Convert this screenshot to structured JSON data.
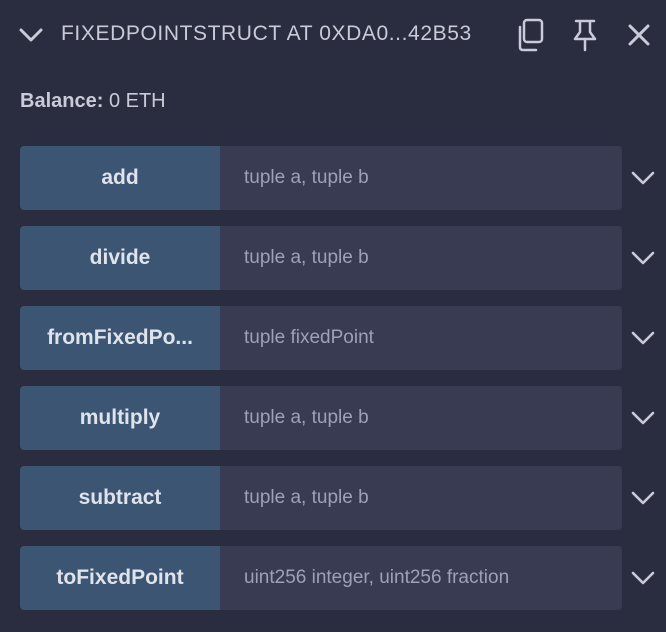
{
  "header": {
    "title": "FIXEDPOINTSTRUCT AT 0XDA0...42B53",
    "icons": {
      "collapse": "chevron-down-icon",
      "copy": "copy-icon",
      "pin": "pin-icon",
      "close": "close-icon"
    }
  },
  "balance": {
    "label": "Balance:",
    "value": "0 ETH"
  },
  "functions": [
    {
      "name": "add",
      "placeholder": "tuple a, tuple b"
    },
    {
      "name": "divide",
      "placeholder": "tuple a, tuple b"
    },
    {
      "name": "fromFixedPo...",
      "placeholder": "tuple fixedPoint"
    },
    {
      "name": "multiply",
      "placeholder": "tuple a, tuple b"
    },
    {
      "name": "subtract",
      "placeholder": "tuple a, tuple b"
    },
    {
      "name": "toFixedPoint",
      "placeholder": "uint256 integer, uint256 fraction"
    }
  ],
  "colors": {
    "background": "#2a2c3f",
    "button": "#3b5572",
    "input": "#393b52",
    "text": "#c9cbd9"
  }
}
